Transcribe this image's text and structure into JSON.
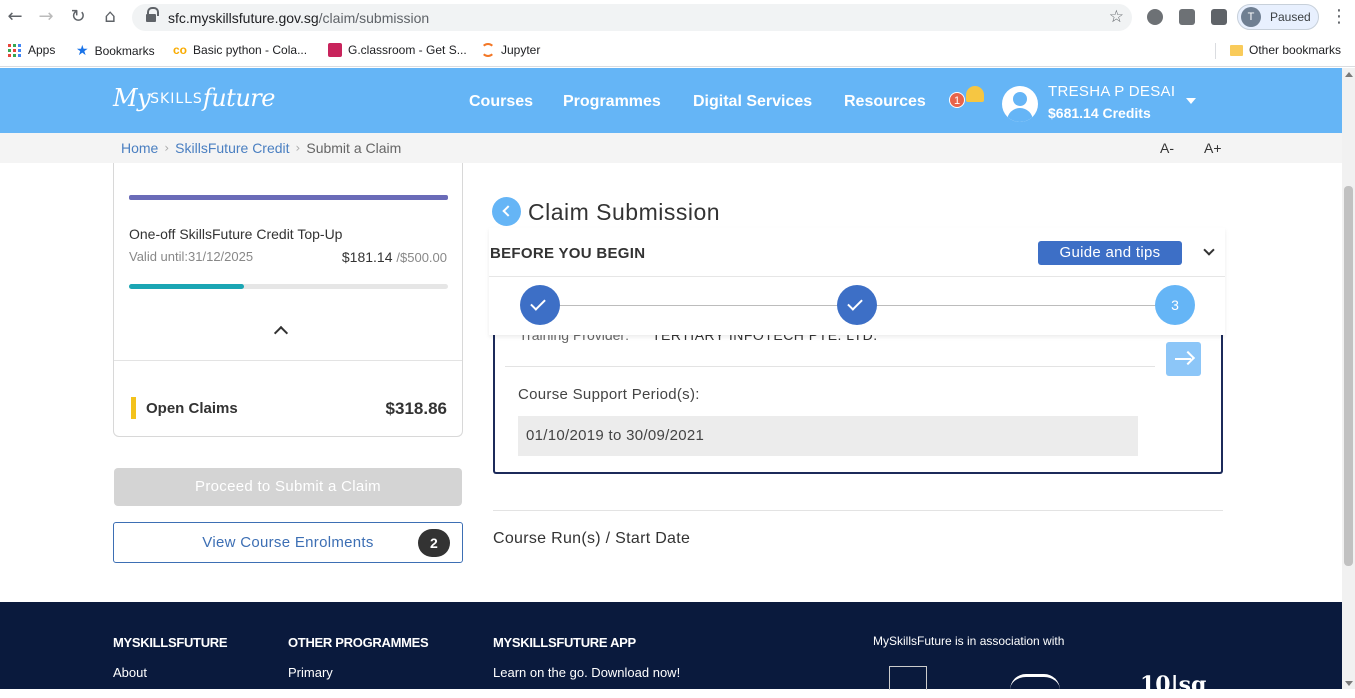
{
  "browser": {
    "url_domain": "sfc.myskillsfuture.gov.sg",
    "url_path": "/claim/submission",
    "profile_initial": "T",
    "profile_status": "Paused",
    "bookmarks": [
      "Apps",
      "Bookmarks",
      "Basic python - Cola...",
      "G.classroom - Get S...",
      "Jupyter"
    ],
    "other_bookmarks": "Other bookmarks"
  },
  "header": {
    "logo_my": "My",
    "logo_skills": "SKILLS",
    "logo_future": "future",
    "nav": [
      "Courses",
      "Programmes",
      "Digital Services",
      "Resources"
    ],
    "notification_count": "1",
    "user_name": "TRESHA P DESAI",
    "user_credits": "$681.14 Credits"
  },
  "breadcrumb": {
    "home": "Home",
    "credit": "SkillsFuture Credit",
    "current": "Submit a Claim",
    "font_decrease": "A-",
    "font_increase": "A+"
  },
  "credit_card": {
    "topup_title": "One-off SkillsFuture Credit Top-Up",
    "valid_until": "Valid until:31/12/2025",
    "balance": "$181.14",
    "total": "/$500.00",
    "progress_fraction": 0.362,
    "open_claims_label": "Open Claims",
    "open_claims_value": "$318.86"
  },
  "actions": {
    "proceed_label": "Proceed to Submit a Claim",
    "enrolments_label": "View Course Enrolments",
    "enrolments_count": "2"
  },
  "claim": {
    "title": "Claim Submission",
    "before_you_begin": "BEFORE YOU BEGIN",
    "guide_label": "Guide and tips",
    "current_step": "3",
    "training_provider_label": "Training Provider:",
    "training_provider_value": "TERTIARY INFOTECH PTE. LTD.",
    "support_period_label": "Course Support Period(s):",
    "support_period_value": "01/10/2019 to 30/09/2021",
    "course_run_label": "Course Run(s) / Start Date"
  },
  "footer": {
    "col1_head": "MYSKILLSFUTURE",
    "col1_link": "About",
    "col2_head": "OTHER PROGRAMMES",
    "col2_link": "Primary",
    "col3_head": "MYSKILLSFUTURE APP",
    "col3_link": "Learn on the go. Download now!",
    "association": "MySkillsFuture is in association with",
    "partner_logo_text": "10|sg"
  },
  "colors": {
    "header_bg": "#65b5f6",
    "accent_blue": "#3d6fc6",
    "footer_bg": "#0a1a3d",
    "progress_teal": "#1ba6b4",
    "open_claims_marker": "#f3c21c"
  }
}
